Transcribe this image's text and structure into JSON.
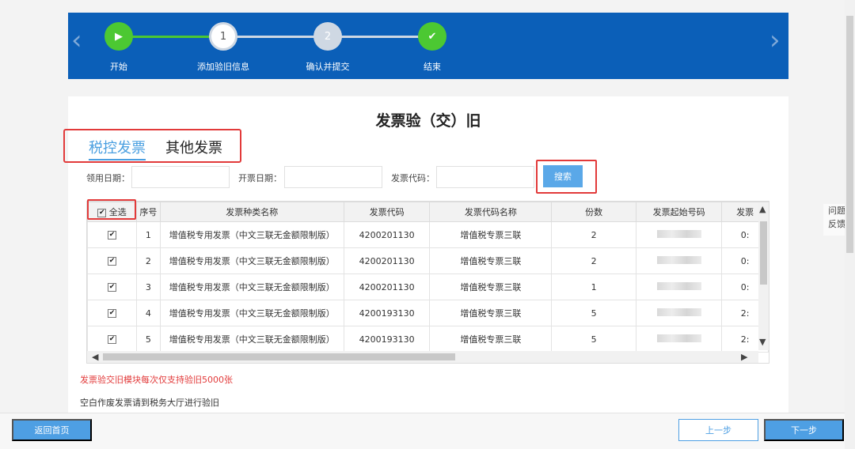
{
  "stepper": {
    "steps": [
      {
        "label": "开始",
        "marker": "▶",
        "state": "done"
      },
      {
        "label": "添加验旧信息",
        "marker": "1",
        "state": "current"
      },
      {
        "label": "确认并提交",
        "marker": "2",
        "state": "todo"
      },
      {
        "label": "结束",
        "marker": "✔",
        "state": "done"
      }
    ],
    "colors": {
      "bar": "#0b5fb8",
      "done": "#4cc832",
      "todo": "#cfd8e3"
    }
  },
  "page": {
    "title": "发票验（交）旧"
  },
  "tabs": [
    {
      "label": "税控发票",
      "active": true
    },
    {
      "label": "其他发票",
      "active": false
    }
  ],
  "filters": {
    "issue_date_label": "领用日期：",
    "invoice_date_label": "开票日期：",
    "invoice_code_label": "发票代码：",
    "search_label": "搜索"
  },
  "table": {
    "select_all_label": "全选",
    "columns": [
      "序号",
      "发票种类名称",
      "发票代码",
      "发票代码名称",
      "份数",
      "发票起始号码",
      "发票"
    ],
    "rows": [
      {
        "index": "1",
        "type_name": "增值税专用发票（中文三联无金额限制版）",
        "code": "4200201130",
        "code_name": "增值税专票三联",
        "count": "2",
        "start_no": "",
        "partial": "0:"
      },
      {
        "index": "2",
        "type_name": "增值税专用发票（中文三联无金额限制版）",
        "code": "4200201130",
        "code_name": "增值税专票三联",
        "count": "2",
        "start_no": "",
        "partial": "0:"
      },
      {
        "index": "3",
        "type_name": "增值税专用发票（中文三联无金额限制版）",
        "code": "4200201130",
        "code_name": "增值税专票三联",
        "count": "1",
        "start_no": "",
        "partial": "0:"
      },
      {
        "index": "4",
        "type_name": "增值税专用发票（中文三联无金额限制版）",
        "code": "4200193130",
        "code_name": "增值税专票三联",
        "count": "5",
        "start_no": "",
        "partial": "2:"
      },
      {
        "index": "5",
        "type_name": "增值税专用发票（中文三联无金额限制版）",
        "code": "4200193130",
        "code_name": "增值税专票三联",
        "count": "5",
        "start_no": "",
        "partial": "2:"
      }
    ]
  },
  "notes": {
    "limit": "发票验交旧模块每次仅支持验旧5000张",
    "blank": "空白作废发票请到税务大厅进行验旧"
  },
  "footer": {
    "home_label": "返回首页",
    "prev_label": "上一步",
    "next_label": "下一步"
  },
  "side": {
    "feedback_line1": "问题",
    "feedback_line2": "反馈"
  }
}
